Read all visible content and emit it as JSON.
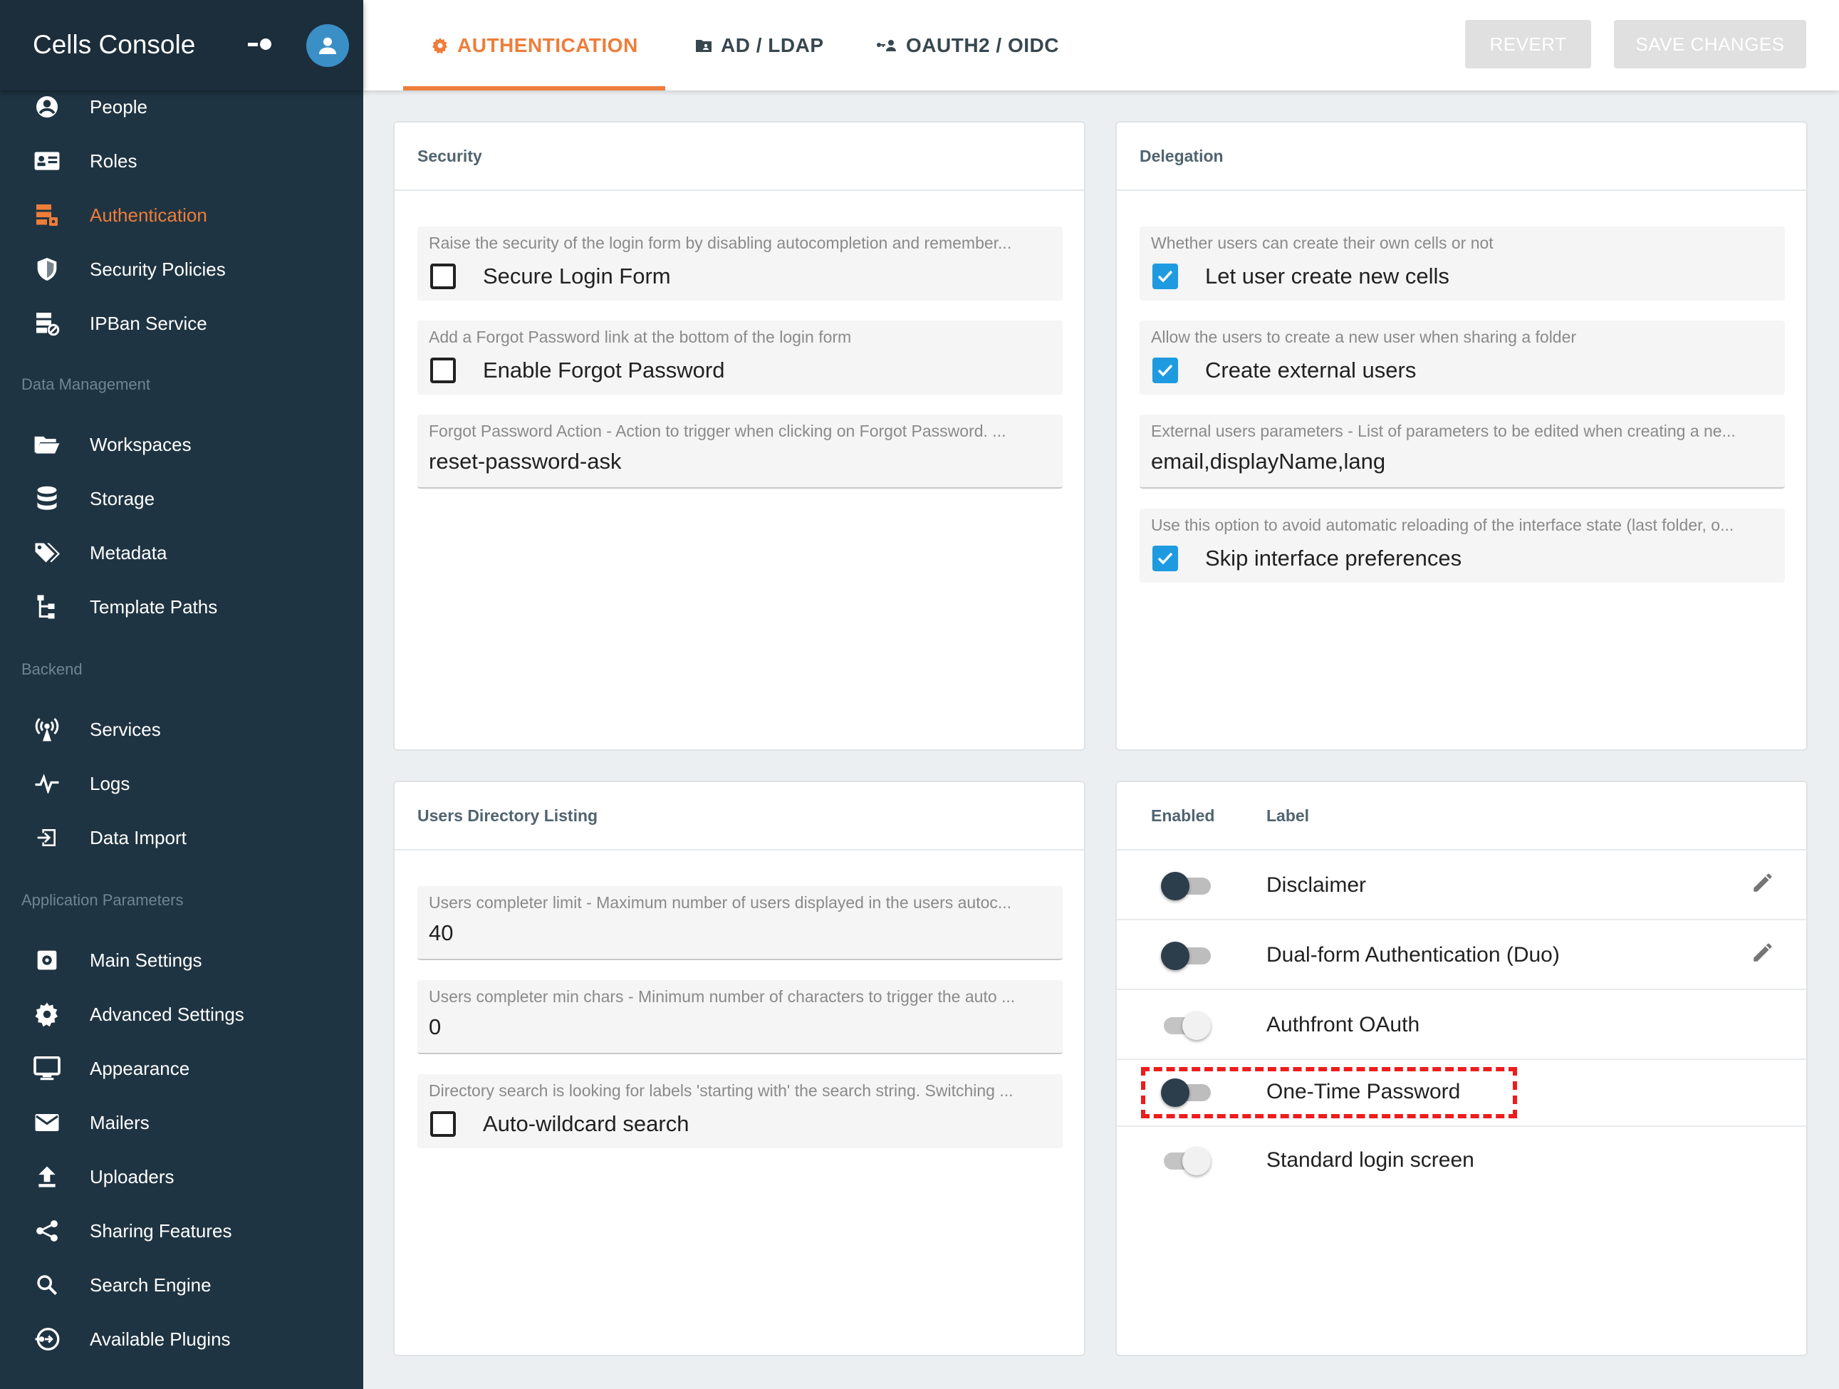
{
  "sidebar": {
    "title": "Cells Console",
    "items": [
      {
        "label": "People",
        "icon": "account-circle-icon"
      },
      {
        "label": "Roles",
        "icon": "id-card-icon"
      },
      {
        "label": "Authentication",
        "icon": "server-security-icon"
      },
      {
        "label": "Security Policies",
        "icon": "shield-icon"
      },
      {
        "label": "IPBan Service",
        "icon": "server-ban-icon"
      },
      {
        "label": "Workspaces",
        "icon": "folder-open-icon"
      },
      {
        "label": "Storage",
        "icon": "database-icon"
      },
      {
        "label": "Metadata",
        "icon": "tags-icon"
      },
      {
        "label": "Template Paths",
        "icon": "file-tree-icon"
      },
      {
        "label": "Services",
        "icon": "radio-tower-icon"
      },
      {
        "label": "Logs",
        "icon": "pulse-icon"
      },
      {
        "label": "Data Import",
        "icon": "import-icon"
      },
      {
        "label": "Main Settings",
        "icon": "settings-box-icon"
      },
      {
        "label": "Advanced Settings",
        "icon": "gear-icon"
      },
      {
        "label": "Appearance",
        "icon": "monitor-icon"
      },
      {
        "label": "Mailers",
        "icon": "mail-icon"
      },
      {
        "label": "Uploaders",
        "icon": "upload-icon"
      },
      {
        "label": "Sharing Features",
        "icon": "share-icon"
      },
      {
        "label": "Search Engine",
        "icon": "search-icon"
      },
      {
        "label": "Available Plugins",
        "icon": "plugin-icon"
      }
    ],
    "active_item": "Authentication",
    "sections": [
      "Data Management",
      "Backend",
      "Application Parameters"
    ]
  },
  "tabs": [
    {
      "label": "AUTHENTICATION",
      "icon": "gear-icon"
    },
    {
      "label": "AD / LDAP",
      "icon": "folder-account-icon"
    },
    {
      "label": "OAUTH2 / OIDC",
      "icon": "account-key-icon"
    }
  ],
  "buttons": {
    "revert": "REVERT",
    "save": "SAVE CHANGES"
  },
  "security": {
    "title": "Security",
    "secure_login_desc": "Raise the security of the login form by disabling autocompletion and remember...",
    "secure_login_label": "Secure Login Form",
    "forgot_desc": "Add a Forgot Password link at the bottom of the login form",
    "forgot_label": "Enable Forgot Password",
    "forgot_action_desc": "Forgot Password Action - Action to trigger when clicking on Forgot Password. ...",
    "forgot_action_value": "reset-password-ask"
  },
  "delegation": {
    "title": "Delegation",
    "create_cells_desc": "Whether users can create their own cells or not",
    "create_cells_label": "Let user create new cells",
    "external_desc": "Allow the users to create a new user when sharing a folder",
    "external_label": "Create external users",
    "params_desc": "External users parameters - List of parameters to be edited when creating a ne...",
    "params_value": "email,displayName,lang",
    "skip_desc": "Use this option to avoid automatic reloading of the interface state (last folder, o...",
    "skip_label": "Skip interface preferences"
  },
  "directory": {
    "title": "Users Directory Listing",
    "limit_desc": "Users completer limit - Maximum number of users displayed in the users autoc...",
    "limit_value": "40",
    "minchars_desc": "Users completer min chars - Minimum number of characters to trigger the auto ...",
    "minchars_value": "0",
    "wildcard_desc": "Directory search is looking for labels 'starting with' the search string. Switching ...",
    "wildcard_label": "Auto-wildcard search"
  },
  "plugins": {
    "col_enabled": "Enabled",
    "col_label": "Label",
    "rows": [
      {
        "label": "Disclaimer"
      },
      {
        "label": "Dual-form Authentication (Duo)"
      },
      {
        "label": "Authfront OAuth"
      },
      {
        "label": "One-Time Password"
      },
      {
        "label": "Standard login screen"
      }
    ]
  },
  "colors": {
    "accent": "#ee7d3a",
    "sidebar": "#1f3442",
    "checkbox": "#1e9be0",
    "highlight": "#ee1c1c"
  }
}
